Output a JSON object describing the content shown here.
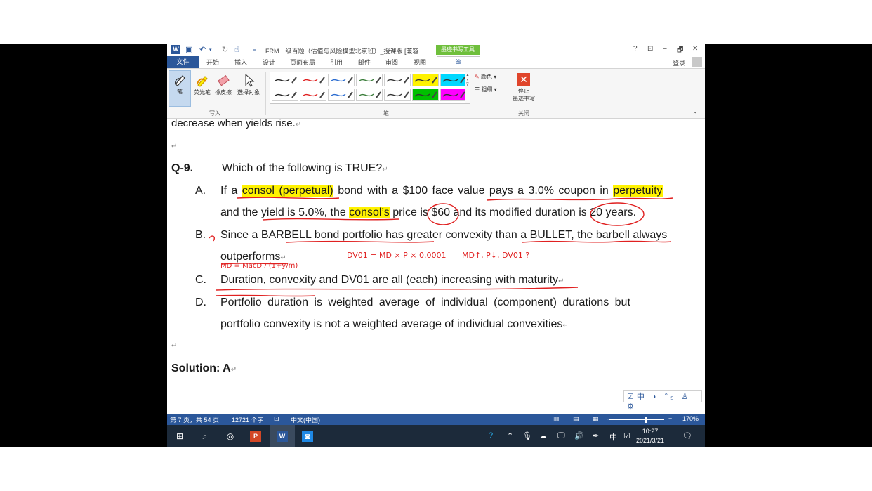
{
  "window": {
    "title": "FRM一级百题（估值与风险模型北京班）_授课版 [兼容...",
    "ink_tools_label": "墨迹书写工具",
    "controls": [
      "?",
      "⊡",
      "–",
      "🗗",
      "✕"
    ],
    "login": "登录"
  },
  "tabs": [
    "文件",
    "开始",
    "插入",
    "设计",
    "页面布局",
    "引用",
    "邮件",
    "审阅",
    "视图",
    "笔"
  ],
  "ribbon": {
    "write_tools": [
      "笔",
      "荧光笔",
      "橡皮擦",
      "选择对象"
    ],
    "write_group": "写入",
    "pens_group": "笔",
    "color_label": "颜色",
    "thickness_label": "粗细",
    "stop_label_1": "停止",
    "stop_label_2": "墨迹书写",
    "close_group": "关闭",
    "swatch_colors": [
      "#ffffff",
      "#ffffff",
      "#ffffff",
      "#ffffff",
      "#ffffff",
      "#fff200",
      "#00d8ff",
      "#ffffff",
      "#ffffff",
      "#ffffff",
      "#ffffff",
      "#ffffff",
      "#00c000",
      "#ff00ff"
    ]
  },
  "document": {
    "line0": "decrease when yields rise.",
    "q_label": "Q-9.",
    "q_text": "Which of the following is TRUE?",
    "a_label": "A.",
    "a1_pre": "If a",
    "a1_hl1": "consol (perpetual)",
    "a1_mid": "bond with a $100 face value pays a 3.0% coupon in",
    "a1_hl2": "perpetuity",
    "a2_pre": "and the yield is 5.0%, the",
    "a2_hl": "consol’s",
    "a2_post": "price is $60 and its modified duration is 20 years.",
    "b_label": "B.",
    "b1": "Since a BARBELL bond portfolio has greater convexity than a BULLET, the barbell always",
    "b2": "outperforms",
    "ink_note_1": "DV01 = MD × P × 0.0001",
    "ink_note_2": "MD↑, P↓, DV01 ?",
    "ink_note_3": "MD = MacD / (1+y/m)",
    "c_label": "C.",
    "c_text": "Duration, convexity and DV01 are all (each) increasing with maturity",
    "d_label": "D.",
    "d1": "Portfolio duration is weighted average of individual (component) durations but",
    "d2": "portfolio convexity is not a weighted average of individual convexities",
    "solution": "Solution: A"
  },
  "ime": "☑中 ◗ °₅ ♙ ⚙",
  "status": {
    "page": "第 7 页，共 54 页",
    "words": "12721 个字",
    "lang": "中文(中国)",
    "zoom": "170%"
  },
  "taskbar": {
    "time": "10:27",
    "date": "2021/3/21",
    "ime_char": "中"
  }
}
